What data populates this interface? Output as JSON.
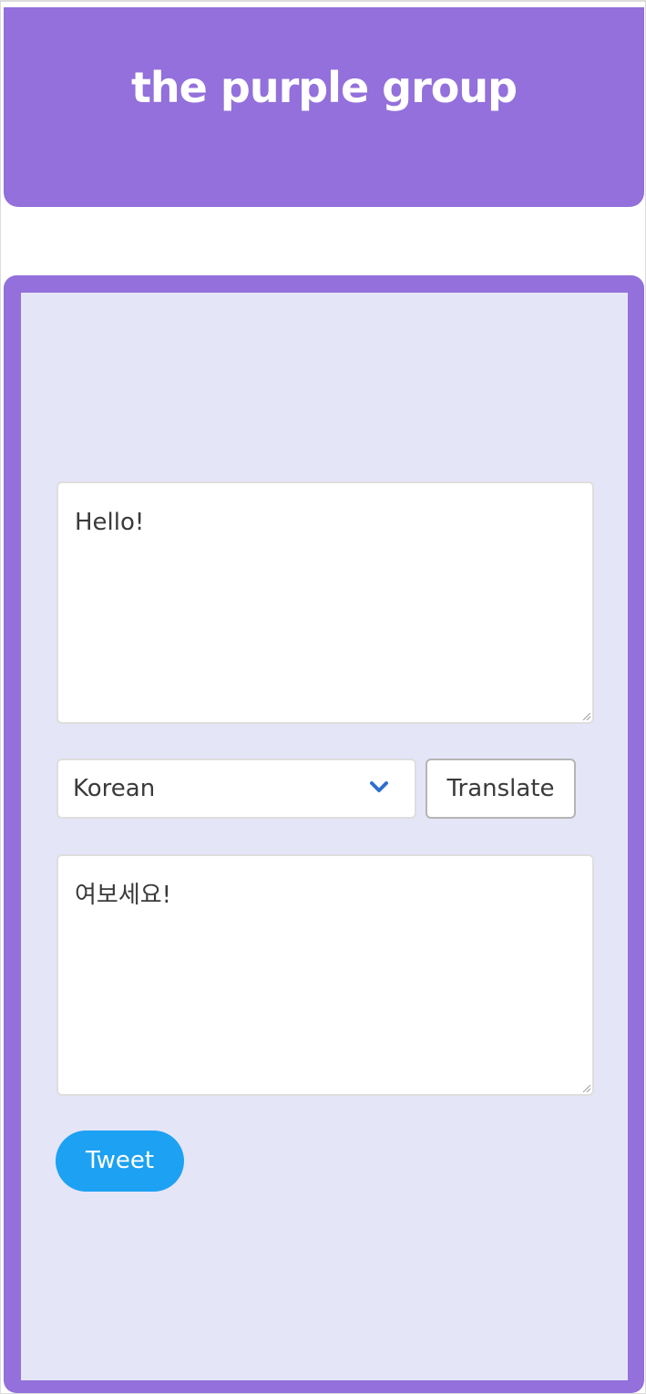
{
  "header": {
    "title": "the purple group",
    "background": "#9370db"
  },
  "translator": {
    "input_text": "Hello!",
    "language": {
      "selected": "Korean",
      "icon": "chevron-down-icon"
    },
    "translate_label": "Translate",
    "output_text": "여보세요!",
    "tweet_label": "Tweet"
  },
  "colors": {
    "accent": "#9370db",
    "panel_background": "#e5e5f8",
    "tweet_blue": "#1da1f2",
    "chevron_blue": "#2f6fd0"
  }
}
